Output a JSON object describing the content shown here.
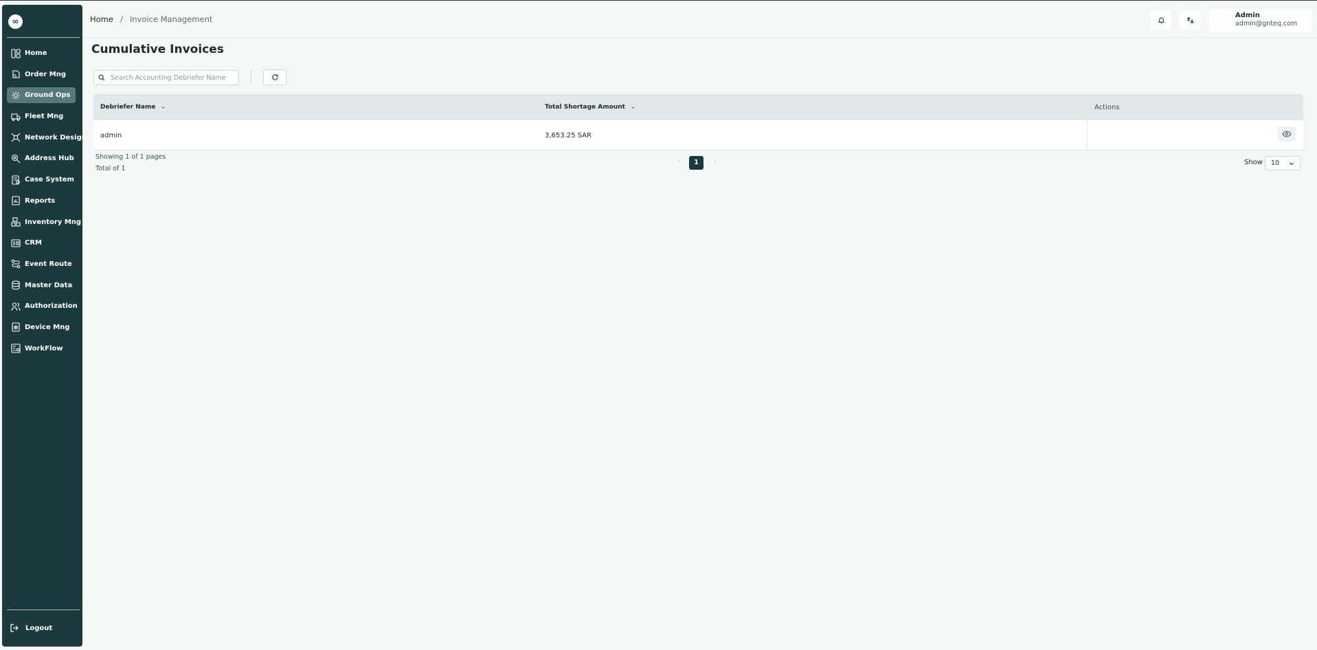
{
  "sidebar": {
    "logo_text": "∞",
    "items": [
      {
        "label": "Home",
        "icon": "dashboard-icon",
        "active": false
      },
      {
        "label": "Order Mng",
        "icon": "order-icon",
        "active": false
      },
      {
        "label": "Ground Ops",
        "icon": "ground-ops-icon",
        "active": true
      },
      {
        "label": "Fleet Mng",
        "icon": "truck-icon",
        "active": false
      },
      {
        "label": "Network Design",
        "icon": "network-icon",
        "active": false
      },
      {
        "label": "Address Hub",
        "icon": "location-icon",
        "active": false
      },
      {
        "label": "Case System",
        "icon": "case-icon",
        "active": false
      },
      {
        "label": "Reports",
        "icon": "report-icon",
        "active": false
      },
      {
        "label": "Inventory Mng",
        "icon": "inventory-icon",
        "active": false
      },
      {
        "label": "CRM",
        "icon": "crm-icon",
        "active": false
      },
      {
        "label": "Event Route",
        "icon": "route-icon",
        "active": false
      },
      {
        "label": "Master Data",
        "icon": "database-icon",
        "active": false
      },
      {
        "label": "Authorization",
        "icon": "users-icon",
        "active": false
      },
      {
        "label": "Device Mng",
        "icon": "device-icon",
        "active": false
      },
      {
        "label": "WorkFlow",
        "icon": "workflow-icon",
        "active": false
      }
    ],
    "logout_label": "Logout"
  },
  "header": {
    "breadcrumb": {
      "home": "Home",
      "separator": "/",
      "current": "Invoice Management"
    },
    "user": {
      "name": "Admin",
      "email": "admin@gnteq.com"
    }
  },
  "page": {
    "title": "Cumulative Invoices",
    "search_placeholder": "Search Accounting Debriefer Name"
  },
  "table": {
    "columns": [
      "Debriefer Name",
      "Total Shortage Amount",
      "Actions"
    ],
    "rows": [
      {
        "debriefer_name": "admin",
        "total_shortage_amount": "3,653.25 SAR"
      }
    ]
  },
  "pagination": {
    "showing": "Showing 1 of 1 pages",
    "total": "Total of 1",
    "current_page": "1",
    "prev": "‹",
    "next": "›",
    "show_label": "Show",
    "page_size": "10"
  },
  "colors": {
    "sidebar_bg": "#1c3a3e",
    "active_item_bg": "#58777a",
    "page_bg": "#f5f7f7",
    "accent": "#1c3a3e"
  }
}
